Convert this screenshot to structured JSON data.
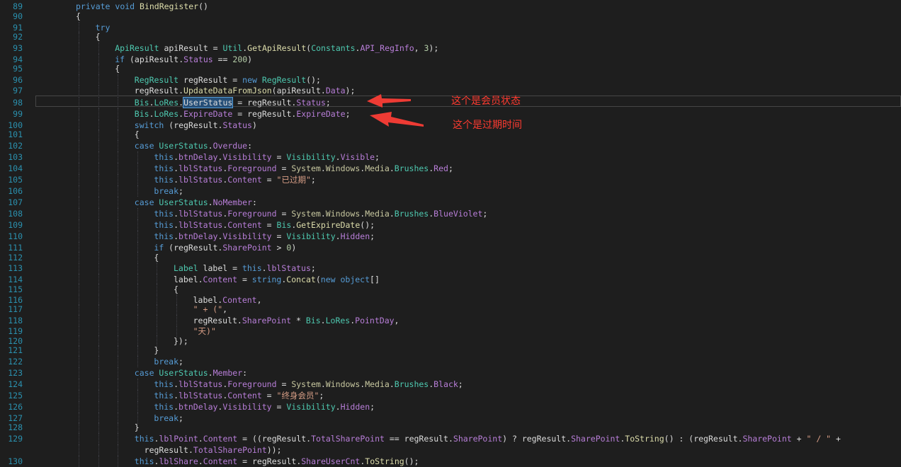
{
  "colors": {
    "background": "#1e1e1e",
    "line_number": "#2b91af",
    "keyword": "#569cd6",
    "type": "#4ec9b0",
    "property": "#b87ed8",
    "method": "#dcdcaa",
    "string": "#d69d85",
    "annotation": "#ff3b30"
  },
  "lines": [
    {
      "n": "89",
      "indent": 1,
      "tokens": [
        [
          "kw",
          "private "
        ],
        [
          "kw",
          "void "
        ],
        [
          "meth",
          "BindRegister"
        ],
        [
          "id",
          "()"
        ]
      ]
    },
    {
      "n": "90",
      "indent": 1,
      "tokens": [
        [
          "id",
          "{"
        ]
      ]
    },
    {
      "n": "91",
      "indent": 2,
      "tokens": [
        [
          "kw",
          "try"
        ]
      ]
    },
    {
      "n": "92",
      "indent": 2,
      "tokens": [
        [
          "id",
          "{"
        ]
      ]
    },
    {
      "n": "93",
      "indent": 3,
      "tokens": [
        [
          "ty",
          "ApiResult "
        ],
        [
          "id",
          "apiResult = "
        ],
        [
          "ty",
          "Util"
        ],
        [
          "id",
          "."
        ],
        [
          "meth",
          "GetApiResult"
        ],
        [
          "id",
          "("
        ],
        [
          "ty",
          "Constants"
        ],
        [
          "id",
          "."
        ],
        [
          "prop",
          "API_RegInfo"
        ],
        [
          "id",
          ", "
        ],
        [
          "num",
          "3"
        ],
        [
          "id",
          ");"
        ]
      ]
    },
    {
      "n": "94",
      "indent": 3,
      "tokens": [
        [
          "kw",
          "if "
        ],
        [
          "id",
          "(apiResult."
        ],
        [
          "prop",
          "Status"
        ],
        [
          "id",
          " == "
        ],
        [
          "num",
          "200"
        ],
        [
          "id",
          ")"
        ]
      ]
    },
    {
      "n": "95",
      "indent": 3,
      "tokens": [
        [
          "id",
          "{"
        ]
      ]
    },
    {
      "n": "96",
      "indent": 4,
      "tokens": [
        [
          "ty",
          "RegResult "
        ],
        [
          "id",
          "regResult = "
        ],
        [
          "kw",
          "new "
        ],
        [
          "ty",
          "RegResult"
        ],
        [
          "id",
          "();"
        ]
      ]
    },
    {
      "n": "97",
      "indent": 4,
      "tokens": [
        [
          "id",
          "regResult."
        ],
        [
          "meth",
          "UpdateDataFromJson"
        ],
        [
          "id",
          "(apiResult."
        ],
        [
          "prop",
          "Data"
        ],
        [
          "id",
          ");"
        ]
      ]
    },
    {
      "n": "98",
      "indent": 4,
      "tokens": [
        [
          "ty",
          "Bis"
        ],
        [
          "id",
          "."
        ],
        [
          "ty",
          "LoRes"
        ],
        [
          "id",
          "."
        ],
        [
          "sel",
          "UserStatus"
        ],
        [
          "id",
          " = regResult."
        ],
        [
          "prop",
          "Status"
        ],
        [
          "id",
          ";"
        ]
      ]
    },
    {
      "n": "99",
      "indent": 4,
      "tokens": [
        [
          "ty",
          "Bis"
        ],
        [
          "id",
          "."
        ],
        [
          "ty",
          "LoRes"
        ],
        [
          "id",
          "."
        ],
        [
          "prop",
          "ExpireDate"
        ],
        [
          "id",
          " = regResult."
        ],
        [
          "prop",
          "ExpireDate"
        ],
        [
          "id",
          ";"
        ]
      ]
    },
    {
      "n": "100",
      "indent": 4,
      "tokens": [
        [
          "kw",
          "switch "
        ],
        [
          "id",
          "(regResult."
        ],
        [
          "prop",
          "Status"
        ],
        [
          "id",
          ")"
        ]
      ]
    },
    {
      "n": "101",
      "indent": 4,
      "tokens": [
        [
          "id",
          "{"
        ]
      ]
    },
    {
      "n": "102",
      "indent": 4,
      "tokens": [
        [
          "kw",
          "case "
        ],
        [
          "ty",
          "UserStatus"
        ],
        [
          "id",
          "."
        ],
        [
          "prop",
          "Overdue"
        ],
        [
          "id",
          ":"
        ]
      ]
    },
    {
      "n": "103",
      "indent": 5,
      "tokens": [
        [
          "kw",
          "this"
        ],
        [
          "id",
          "."
        ],
        [
          "prop",
          "btnDelay"
        ],
        [
          "id",
          "."
        ],
        [
          "prop",
          "Visibility"
        ],
        [
          "id",
          " = "
        ],
        [
          "ty",
          "Visibility"
        ],
        [
          "id",
          "."
        ],
        [
          "prop",
          "Visible"
        ],
        [
          "id",
          ";"
        ]
      ]
    },
    {
      "n": "104",
      "indent": 5,
      "tokens": [
        [
          "kw",
          "this"
        ],
        [
          "id",
          "."
        ],
        [
          "prop",
          "lblStatus"
        ],
        [
          "id",
          "."
        ],
        [
          "prop",
          "Foreground"
        ],
        [
          "id",
          " = "
        ],
        [
          "ns",
          "System"
        ],
        [
          "id",
          "."
        ],
        [
          "ns",
          "Windows"
        ],
        [
          "id",
          "."
        ],
        [
          "ns",
          "Media"
        ],
        [
          "id",
          "."
        ],
        [
          "ty",
          "Brushes"
        ],
        [
          "id",
          "."
        ],
        [
          "prop",
          "Red"
        ],
        [
          "id",
          ";"
        ]
      ]
    },
    {
      "n": "105",
      "indent": 5,
      "tokens": [
        [
          "kw",
          "this"
        ],
        [
          "id",
          "."
        ],
        [
          "prop",
          "lblStatus"
        ],
        [
          "id",
          "."
        ],
        [
          "prop",
          "Content"
        ],
        [
          "id",
          " = "
        ],
        [
          "str",
          "\"已过期\""
        ],
        [
          "id",
          ";"
        ]
      ]
    },
    {
      "n": "106",
      "indent": 5,
      "tokens": [
        [
          "kw",
          "break"
        ],
        [
          "id",
          ";"
        ]
      ]
    },
    {
      "n": "107",
      "indent": 4,
      "tokens": [
        [
          "kw",
          "case "
        ],
        [
          "ty",
          "UserStatus"
        ],
        [
          "id",
          "."
        ],
        [
          "prop",
          "NoMember"
        ],
        [
          "id",
          ":"
        ]
      ]
    },
    {
      "n": "108",
      "indent": 5,
      "tokens": [
        [
          "kw",
          "this"
        ],
        [
          "id",
          "."
        ],
        [
          "prop",
          "lblStatus"
        ],
        [
          "id",
          "."
        ],
        [
          "prop",
          "Foreground"
        ],
        [
          "id",
          " = "
        ],
        [
          "ns",
          "System"
        ],
        [
          "id",
          "."
        ],
        [
          "ns",
          "Windows"
        ],
        [
          "id",
          "."
        ],
        [
          "ns",
          "Media"
        ],
        [
          "id",
          "."
        ],
        [
          "ty",
          "Brushes"
        ],
        [
          "id",
          "."
        ],
        [
          "prop",
          "BlueViolet"
        ],
        [
          "id",
          ";"
        ]
      ]
    },
    {
      "n": "109",
      "indent": 5,
      "tokens": [
        [
          "kw",
          "this"
        ],
        [
          "id",
          "."
        ],
        [
          "prop",
          "lblStatus"
        ],
        [
          "id",
          "."
        ],
        [
          "prop",
          "Content"
        ],
        [
          "id",
          " = "
        ],
        [
          "ty",
          "Bis"
        ],
        [
          "id",
          "."
        ],
        [
          "meth",
          "GetExpireDate"
        ],
        [
          "id",
          "();"
        ]
      ]
    },
    {
      "n": "110",
      "indent": 5,
      "tokens": [
        [
          "kw",
          "this"
        ],
        [
          "id",
          "."
        ],
        [
          "prop",
          "btnDelay"
        ],
        [
          "id",
          "."
        ],
        [
          "prop",
          "Visibility"
        ],
        [
          "id",
          " = "
        ],
        [
          "ty",
          "Visibility"
        ],
        [
          "id",
          "."
        ],
        [
          "prop",
          "Hidden"
        ],
        [
          "id",
          ";"
        ]
      ]
    },
    {
      "n": "111",
      "indent": 5,
      "tokens": [
        [
          "kw",
          "if "
        ],
        [
          "id",
          "(regResult."
        ],
        [
          "prop",
          "SharePoint"
        ],
        [
          "id",
          " > "
        ],
        [
          "num",
          "0"
        ],
        [
          "id",
          ")"
        ]
      ]
    },
    {
      "n": "112",
      "indent": 5,
      "tokens": [
        [
          "id",
          "{"
        ]
      ]
    },
    {
      "n": "113",
      "indent": 6,
      "tokens": [
        [
          "ty",
          "Label "
        ],
        [
          "id",
          "label = "
        ],
        [
          "kw",
          "this"
        ],
        [
          "id",
          "."
        ],
        [
          "prop",
          "lblStatus"
        ],
        [
          "id",
          ";"
        ]
      ]
    },
    {
      "n": "114",
      "indent": 6,
      "tokens": [
        [
          "id",
          "label."
        ],
        [
          "prop",
          "Content"
        ],
        [
          "id",
          " = "
        ],
        [
          "kw",
          "string"
        ],
        [
          "id",
          "."
        ],
        [
          "meth",
          "Concat"
        ],
        [
          "id",
          "("
        ],
        [
          "kw",
          "new "
        ],
        [
          "kw",
          "object"
        ],
        [
          "id",
          "[]"
        ]
      ]
    },
    {
      "n": "115",
      "indent": 6,
      "tokens": [
        [
          "id",
          "{"
        ]
      ]
    },
    {
      "n": "116",
      "indent": 7,
      "tokens": [
        [
          "id",
          "label."
        ],
        [
          "prop",
          "Content"
        ],
        [
          "id",
          ","
        ]
      ]
    },
    {
      "n": "117",
      "indent": 7,
      "tokens": [
        [
          "str",
          "\" + (\""
        ],
        [
          "id",
          ","
        ]
      ]
    },
    {
      "n": "118",
      "indent": 7,
      "tokens": [
        [
          "id",
          "regResult."
        ],
        [
          "prop",
          "SharePoint"
        ],
        [
          "id",
          " * "
        ],
        [
          "ty",
          "Bis"
        ],
        [
          "id",
          "."
        ],
        [
          "ty",
          "LoRes"
        ],
        [
          "id",
          "."
        ],
        [
          "prop",
          "PointDay"
        ],
        [
          "id",
          ","
        ]
      ]
    },
    {
      "n": "119",
      "indent": 7,
      "tokens": [
        [
          "str",
          "\"天)\""
        ]
      ]
    },
    {
      "n": "120",
      "indent": 6,
      "tokens": [
        [
          "id",
          "});"
        ]
      ]
    },
    {
      "n": "121",
      "indent": 5,
      "tokens": [
        [
          "id",
          "}"
        ]
      ]
    },
    {
      "n": "122",
      "indent": 5,
      "tokens": [
        [
          "kw",
          "break"
        ],
        [
          "id",
          ";"
        ]
      ]
    },
    {
      "n": "123",
      "indent": 4,
      "tokens": [
        [
          "kw",
          "case "
        ],
        [
          "ty",
          "UserStatus"
        ],
        [
          "id",
          "."
        ],
        [
          "prop",
          "Member"
        ],
        [
          "id",
          ":"
        ]
      ]
    },
    {
      "n": "124",
      "indent": 5,
      "tokens": [
        [
          "kw",
          "this"
        ],
        [
          "id",
          "."
        ],
        [
          "prop",
          "lblStatus"
        ],
        [
          "id",
          "."
        ],
        [
          "prop",
          "Foreground"
        ],
        [
          "id",
          " = "
        ],
        [
          "ns",
          "System"
        ],
        [
          "id",
          "."
        ],
        [
          "ns",
          "Windows"
        ],
        [
          "id",
          "."
        ],
        [
          "ns",
          "Media"
        ],
        [
          "id",
          "."
        ],
        [
          "ty",
          "Brushes"
        ],
        [
          "id",
          "."
        ],
        [
          "prop",
          "Black"
        ],
        [
          "id",
          ";"
        ]
      ]
    },
    {
      "n": "125",
      "indent": 5,
      "tokens": [
        [
          "kw",
          "this"
        ],
        [
          "id",
          "."
        ],
        [
          "prop",
          "lblStatus"
        ],
        [
          "id",
          "."
        ],
        [
          "prop",
          "Content"
        ],
        [
          "id",
          " = "
        ],
        [
          "str",
          "\"终身会员\""
        ],
        [
          "id",
          ";"
        ]
      ]
    },
    {
      "n": "126",
      "indent": 5,
      "tokens": [
        [
          "kw",
          "this"
        ],
        [
          "id",
          "."
        ],
        [
          "prop",
          "btnDelay"
        ],
        [
          "id",
          "."
        ],
        [
          "prop",
          "Visibility"
        ],
        [
          "id",
          " = "
        ],
        [
          "ty",
          "Visibility"
        ],
        [
          "id",
          "."
        ],
        [
          "prop",
          "Hidden"
        ],
        [
          "id",
          ";"
        ]
      ]
    },
    {
      "n": "127",
      "indent": 5,
      "tokens": [
        [
          "kw",
          "break"
        ],
        [
          "id",
          ";"
        ]
      ]
    },
    {
      "n": "128",
      "indent": 4,
      "tokens": [
        [
          "id",
          "}"
        ]
      ]
    },
    {
      "n": "129",
      "indent": 4,
      "tokens": [
        [
          "kw",
          "this"
        ],
        [
          "id",
          "."
        ],
        [
          "prop",
          "lblPoint"
        ],
        [
          "id",
          "."
        ],
        [
          "prop",
          "Content"
        ],
        [
          "id",
          " = ((regResult."
        ],
        [
          "prop",
          "TotalSharePoint"
        ],
        [
          "id",
          " == regResult."
        ],
        [
          "prop",
          "SharePoint"
        ],
        [
          "id",
          ") ? regResult."
        ],
        [
          "prop",
          "SharePoint"
        ],
        [
          "id",
          "."
        ],
        [
          "meth",
          "ToString"
        ],
        [
          "id",
          "() : (regResult."
        ],
        [
          "prop",
          "SharePoint"
        ],
        [
          "id",
          " + "
        ],
        [
          "str",
          "\" / \""
        ],
        [
          "id",
          " +"
        ]
      ]
    },
    {
      "n": "",
      "indent": 4,
      "tokens": [
        [
          "id",
          "  regResult."
        ],
        [
          "prop",
          "TotalSharePoint"
        ],
        [
          "id",
          "));"
        ]
      ]
    },
    {
      "n": "130",
      "indent": 4,
      "tokens": [
        [
          "kw",
          "this"
        ],
        [
          "id",
          "."
        ],
        [
          "prop",
          "lblShare"
        ],
        [
          "id",
          "."
        ],
        [
          "prop",
          "Content"
        ],
        [
          "id",
          " = regResult."
        ],
        [
          "prop",
          "ShareUserCnt"
        ],
        [
          "id",
          "."
        ],
        [
          "meth",
          "ToString"
        ],
        [
          "id",
          "();"
        ]
      ]
    }
  ],
  "annotations": [
    {
      "text": "这个是会员状态"
    },
    {
      "text": "这个是过期时间"
    }
  ]
}
